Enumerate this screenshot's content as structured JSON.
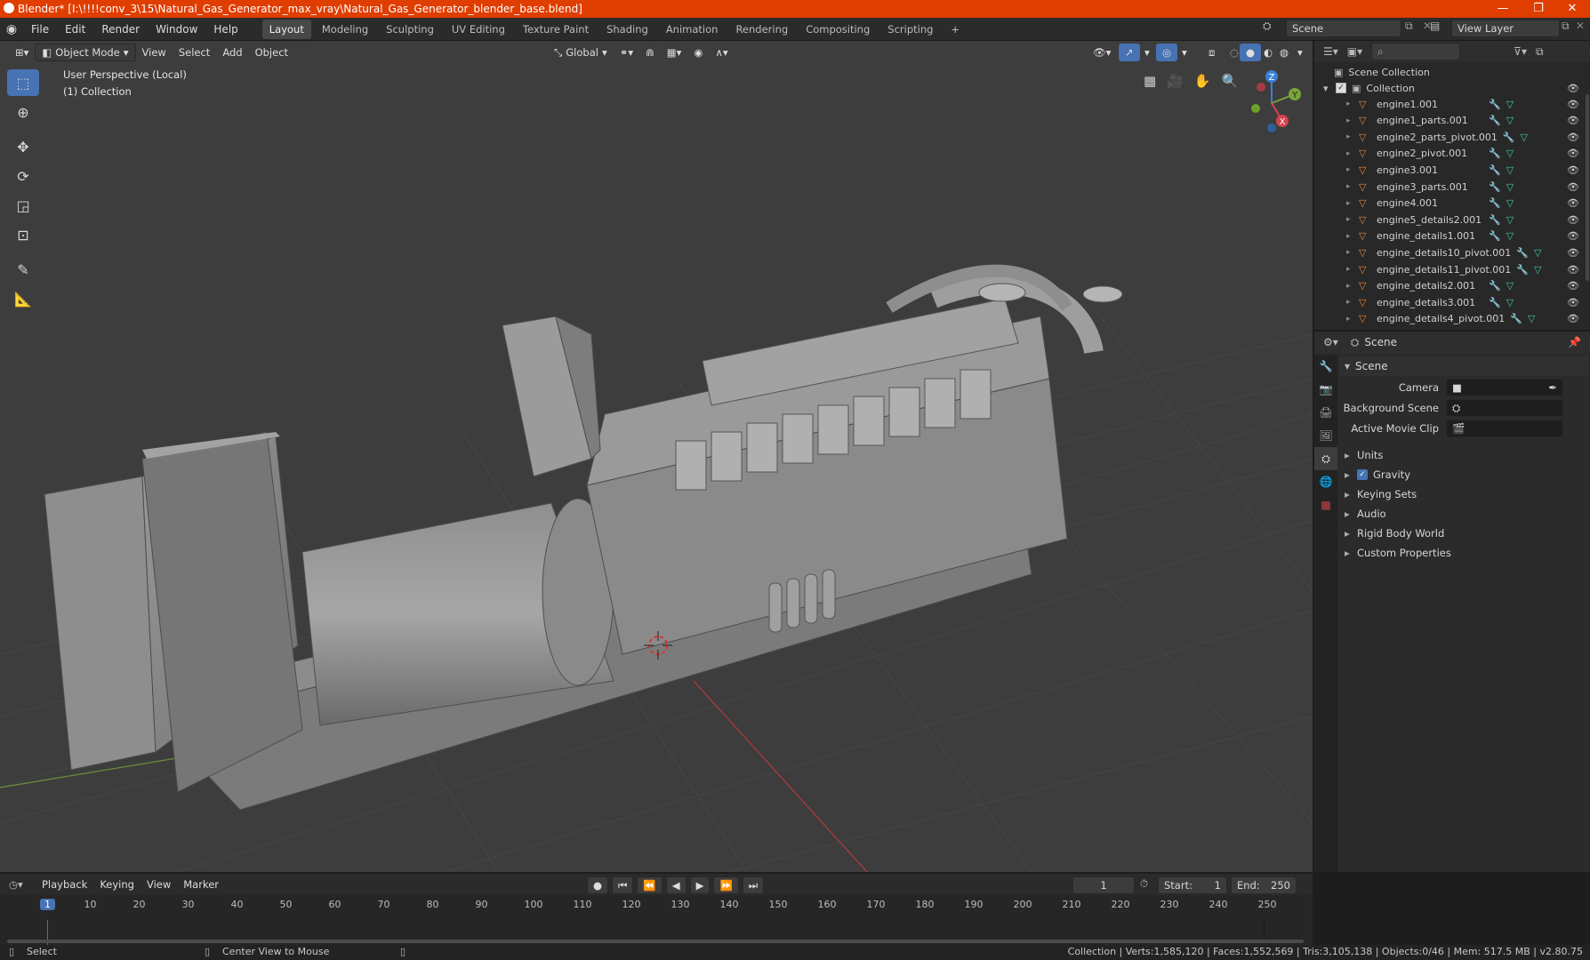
{
  "titlebar": {
    "text": "Blender* [I:\\!!!!conv_3\\15\\Natural_Gas_Generator_max_vray\\Natural_Gas_Generator_blender_base.blend]",
    "minimize": "—",
    "maximize": "❐",
    "close": "✕"
  },
  "menu": [
    "File",
    "Edit",
    "Render",
    "Window",
    "Help"
  ],
  "workspaces": [
    "Layout",
    "Modeling",
    "Sculpting",
    "UV Editing",
    "Texture Paint",
    "Shading",
    "Animation",
    "Rendering",
    "Compositing",
    "Scripting"
  ],
  "workspace_add": "+",
  "scene_field": "Scene",
  "view_layer_field": "View Layer",
  "viewport": {
    "mode": "Object Mode",
    "header_menus": [
      "View",
      "Select",
      "Add",
      "Object"
    ],
    "transform_orientation": "Global",
    "overlay_line1": "User Perspective (Local)",
    "overlay_line2": "(1) Collection",
    "gizmo_axes": {
      "z": "Z",
      "y": "Y",
      "x": "X"
    }
  },
  "outliner": {
    "root": "Scene Collection",
    "collection": "Collection",
    "items": [
      "engine1.001",
      "engine1_parts.001",
      "engine2_parts_pivot.001",
      "engine2_pivot.001",
      "engine3.001",
      "engine3_parts.001",
      "engine4.001",
      "engine5_details2.001",
      "engine_details1.001",
      "engine_details10_pivot.001",
      "engine_details11_pivot.001",
      "engine_details2.001",
      "engine_details3.001",
      "engine_details4_pivot.001"
    ]
  },
  "properties": {
    "context": "Scene",
    "panel_title": "Scene",
    "fields": [
      {
        "label": "Camera",
        "value": ""
      },
      {
        "label": "Background Scene",
        "value": ""
      },
      {
        "label": "Active Movie Clip",
        "value": ""
      }
    ],
    "sections": [
      "Units",
      "Gravity",
      "Keying Sets",
      "Audio",
      "Rigid Body World",
      "Custom Properties"
    ],
    "gravity_checked": true
  },
  "timeline": {
    "menus": [
      "Playback",
      "Keying",
      "View",
      "Marker"
    ],
    "current_frame": "1",
    "start_label": "Start:",
    "start": "1",
    "end_label": "End:",
    "end": "250",
    "ticks": [
      "1",
      "10",
      "20",
      "30",
      "40",
      "50",
      "60",
      "70",
      "80",
      "90",
      "100",
      "110",
      "120",
      "130",
      "140",
      "150",
      "160",
      "170",
      "180",
      "190",
      "200",
      "210",
      "220",
      "230",
      "240",
      "250"
    ]
  },
  "status": {
    "left_action": "Select",
    "middle_action": "Center View to Mouse",
    "stats": "Collection | Verts:1,585,120 | Faces:1,552,569 | Tris:3,105,138 | Objects:0/46 | Mem: 517.5 MB | v2.80.75"
  }
}
